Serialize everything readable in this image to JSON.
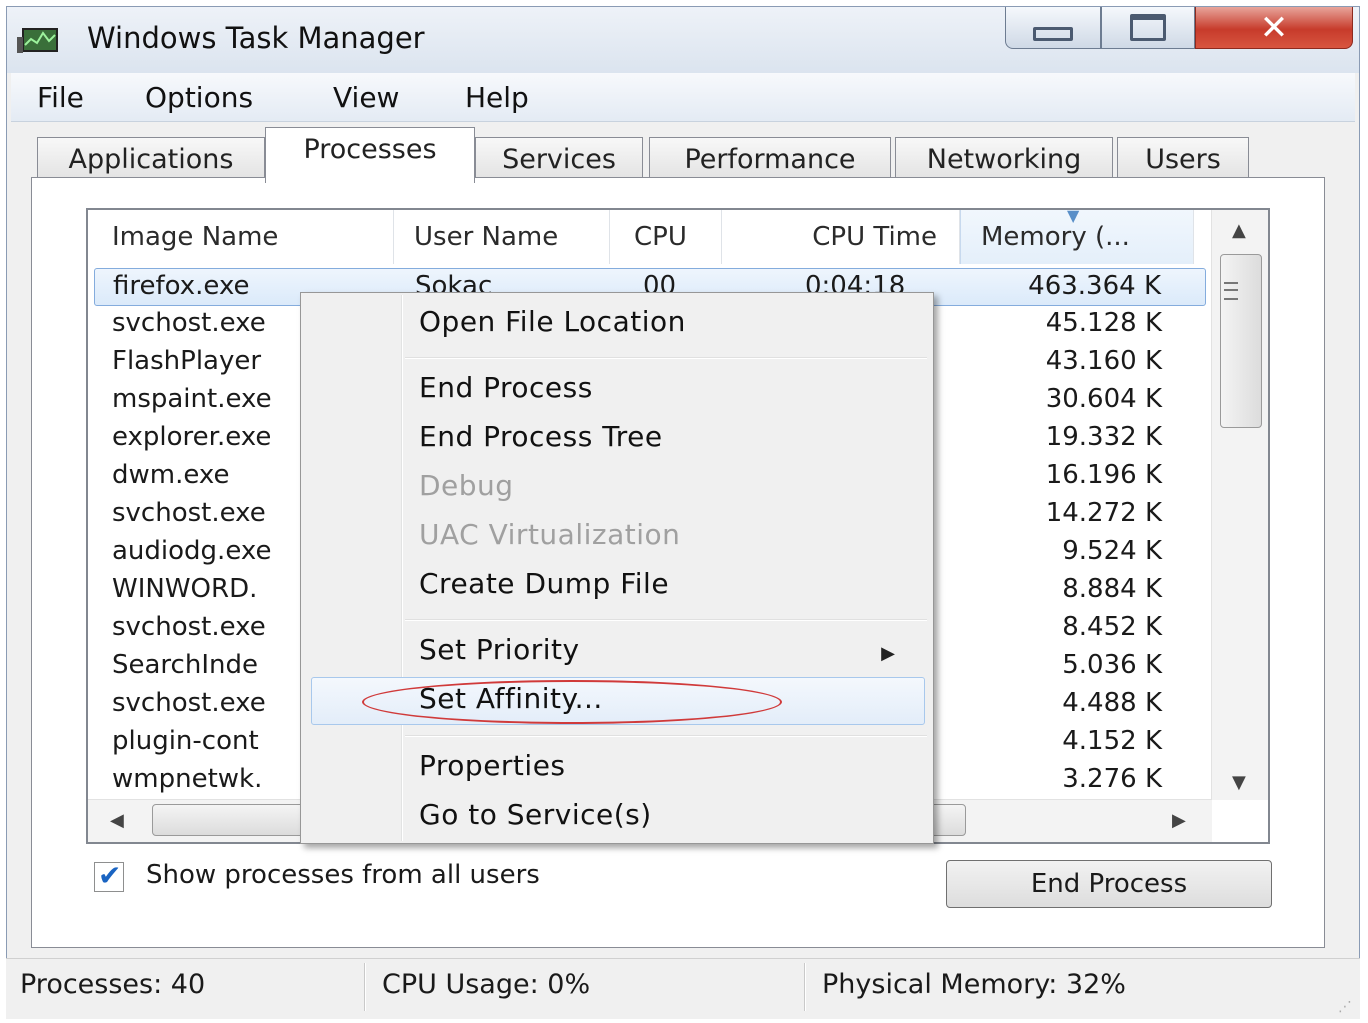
{
  "window": {
    "title": "Windows Task Manager"
  },
  "menubar": [
    "File",
    "Options",
    "View",
    "Help"
  ],
  "tabs": [
    "Applications",
    "Processes",
    "Services",
    "Performance",
    "Networking",
    "Users"
  ],
  "active_tab": "Processes",
  "columns": {
    "image_name": "Image Name",
    "user_name": "User Name",
    "cpu": "CPU",
    "cpu_time": "CPU Time",
    "memory": "Memory (..."
  },
  "selected_row": {
    "image_name": "firefox.exe",
    "user_name": "Sokac",
    "cpu": "00",
    "cpu_time": "0:04:18",
    "memory": "463.364 K"
  },
  "processes": [
    {
      "image_name": "svchost.exe",
      "memory": "45.128 K"
    },
    {
      "image_name": "FlashPlayer",
      "memory": "43.160 K"
    },
    {
      "image_name": "mspaint.exe",
      "memory": "30.604 K"
    },
    {
      "image_name": "explorer.exe",
      "memory": "19.332 K"
    },
    {
      "image_name": "dwm.exe",
      "memory": "16.196 K"
    },
    {
      "image_name": "svchost.exe",
      "memory": "14.272 K"
    },
    {
      "image_name": "audiodg.exe",
      "memory": "9.524 K"
    },
    {
      "image_name": "WINWORD.",
      "memory": "8.884 K"
    },
    {
      "image_name": "svchost.exe",
      "memory": "8.452 K"
    },
    {
      "image_name": "SearchInde",
      "memory": "5.036 K"
    },
    {
      "image_name": "svchost.exe",
      "memory": "4.488 K"
    },
    {
      "image_name": "plugin-cont",
      "memory": "4.152 K"
    },
    {
      "image_name": "wmpnetwk.",
      "memory": "3.276 K"
    }
  ],
  "context_menu": {
    "open_file_location": "Open File Location",
    "end_process": "End Process",
    "end_process_tree": "End Process Tree",
    "debug": "Debug",
    "uac_virtualization": "UAC Virtualization",
    "create_dump_file": "Create Dump File",
    "set_priority": "Set Priority",
    "set_affinity": "Set Affinity...",
    "properties": "Properties",
    "go_to_services": "Go to Service(s)"
  },
  "show_all_users": {
    "label": "Show processes from all users",
    "checked": true
  },
  "end_process_button": "End Process",
  "status": {
    "processes": "Processes: 40",
    "cpu_usage": "CPU Usage: 0%",
    "physical_memory": "Physical Memory: 32%"
  },
  "colors": {
    "highlight_ellipse": "#d03a3a",
    "selection": "#dbeafa",
    "close_button": "#c73b2b"
  }
}
